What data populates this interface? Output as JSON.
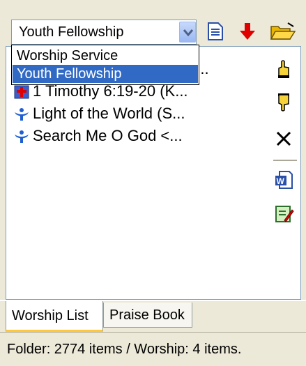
{
  "combo": {
    "value": "Youth Fellowship",
    "options": [
      "Worship Service",
      "Youth Fellowship"
    ],
    "selected_index": 1
  },
  "list": {
    "items": [
      {
        "text": "n...",
        "icon": "song-icon"
      },
      {
        "text": "1 Timothy 6:19-20 (K...",
        "icon": "bible-icon"
      },
      {
        "text": "Light of the World (S...",
        "icon": "song-icon"
      },
      {
        "text": "Search Me O God <...",
        "icon": "song-icon"
      }
    ]
  },
  "toolbar": {
    "icons": [
      "page-icon",
      "move-down-icon",
      "open-folder-icon",
      "move-up-icon",
      "move-down-hand-icon",
      "delete-icon",
      "word-export-icon",
      "edit-notes-icon"
    ]
  },
  "tabs": [
    {
      "label": "Worship List",
      "active": true
    },
    {
      "label": "Praise Book",
      "active": false
    }
  ],
  "status": {
    "text": "Folder: 2774 items / Worship: 4 items."
  },
  "colors": {
    "selection": "#316ac5",
    "song_icon": "#1f5fd1",
    "down_arrow": "#e00000",
    "tab_accent": "#ffc83c"
  }
}
